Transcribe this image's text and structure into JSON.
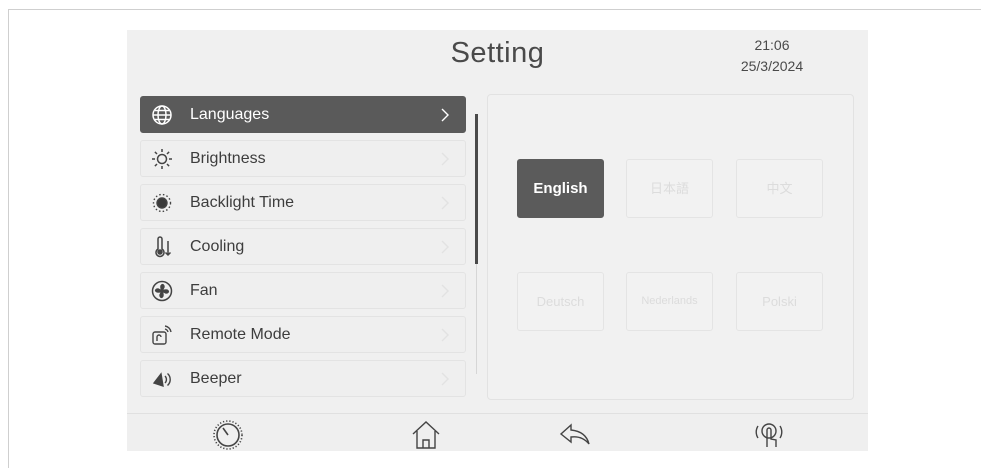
{
  "header": {
    "title": "Setting",
    "time": "21:06",
    "date": "25/3/2024"
  },
  "menu": {
    "items": [
      {
        "label": "Languages",
        "icon": "globe-icon",
        "active": true
      },
      {
        "label": "Brightness",
        "icon": "sun-icon"
      },
      {
        "label": "Backlight Time",
        "icon": "backlight-icon"
      },
      {
        "label": "Cooling",
        "icon": "thermometer-icon"
      },
      {
        "label": "Fan",
        "icon": "fan-icon"
      },
      {
        "label": "Remote Mode",
        "icon": "remote-icon"
      },
      {
        "label": "Beeper",
        "icon": "speaker-icon"
      }
    ]
  },
  "languages": {
    "options": [
      "English",
      "日本語",
      "中文",
      "Deutsch",
      "Nederlands",
      "Polski"
    ],
    "selected": "English"
  },
  "bottom_nav": {
    "icons": [
      "dial-icon",
      "home-icon",
      "back-icon",
      "touch-icon"
    ]
  },
  "colors": {
    "active_bg": "#5a5a5a",
    "screen_bg": "#f0f0f0",
    "text": "#3d3d3d"
  }
}
